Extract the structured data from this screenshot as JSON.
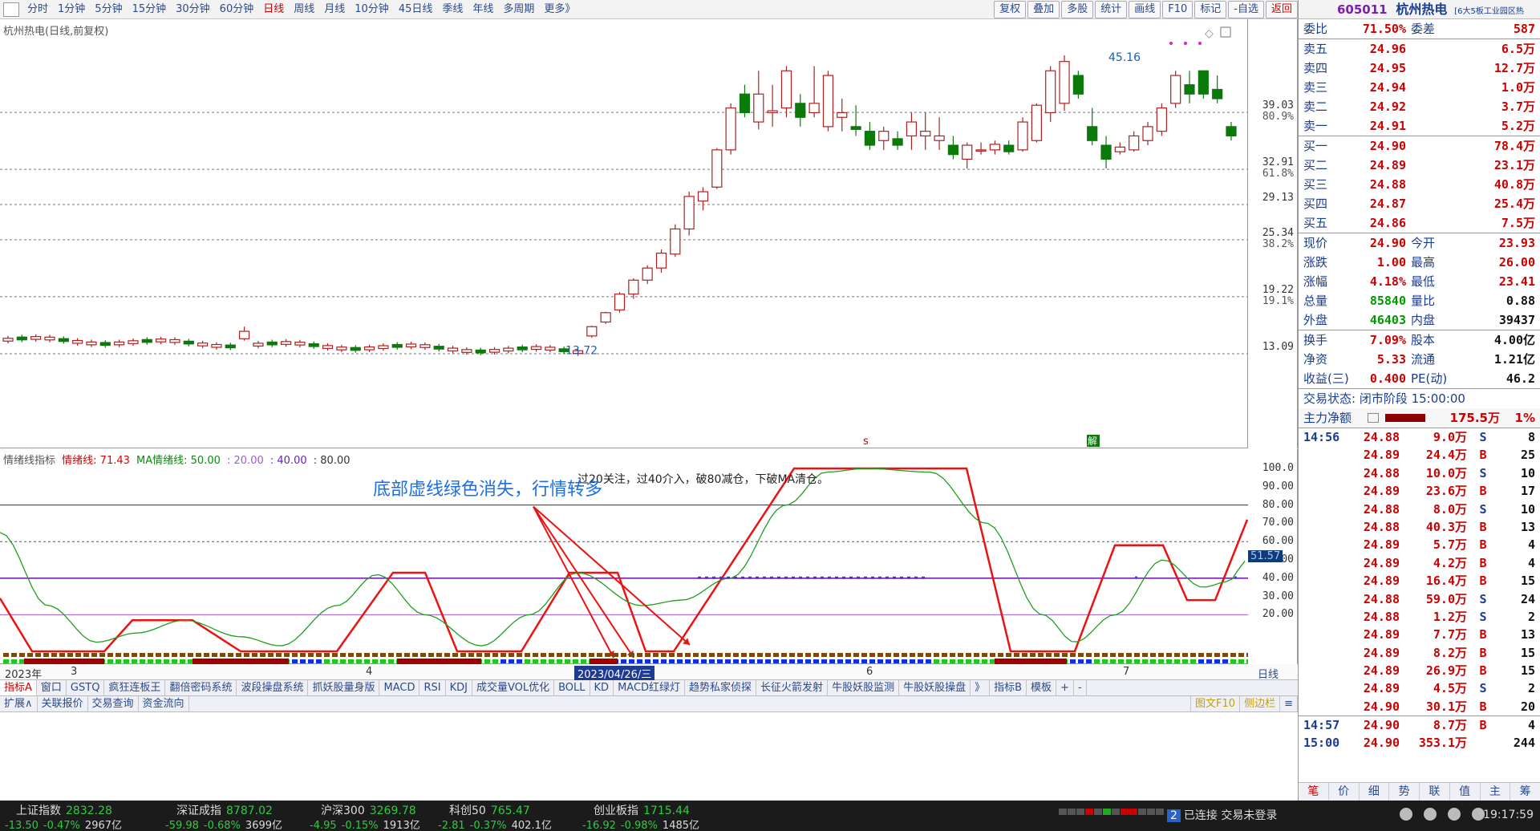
{
  "toolbar": {
    "periods": [
      "分时",
      "1分钟",
      "5分钟",
      "15分钟",
      "30分钟",
      "60分钟",
      "日线",
      "周线",
      "月线",
      "10分钟",
      "45日线",
      "季线",
      "年线",
      "多周期",
      "更多》"
    ],
    "active": "日线",
    "right_buttons": [
      "复权",
      "叠加",
      "多股",
      "统计",
      "画线",
      "F10",
      "标记",
      "-自选",
      "返回"
    ]
  },
  "main_pane": {
    "title": "杭州热电(日线,前复权)",
    "high_label": "45.16",
    "low_label": "13.72",
    "axis_ticks": [
      {
        "v": "39.03",
        "pct": "80.9%"
      },
      {
        "v": "32.91",
        "pct": "61.8%"
      },
      {
        "v": "29.13",
        "pct": ""
      },
      {
        "v": "25.34",
        "pct": "38.2%"
      },
      {
        "v": "19.22",
        "pct": "19.1%"
      },
      {
        "v": "13.09",
        "pct": ""
      }
    ],
    "markers": {
      "s": "s",
      "jie": "解"
    },
    "colors": {
      "up": "#b02020",
      "down": "#0b7a0b"
    }
  },
  "indicator": {
    "name": "情绪线指标",
    "line_label": "情绪线: 71.43",
    "ma_label": "MA情绪线: 50.00",
    "levels": [
      ": 20.00",
      ": 40.00",
      ": 80.00"
    ],
    "note": "过20关注，过40介入，破80减仓，下破MA清仓。",
    "annotation": "底部虚线绿色消失，行情转多",
    "axis_ticks": [
      "100.0",
      "90.00",
      "80.00",
      "70.00",
      "60.00",
      "50.00",
      "40.00",
      "30.00",
      "20.00"
    ],
    "current_value": "51.57"
  },
  "date_axis": {
    "year": "2023年",
    "m3": "3",
    "m4": "4",
    "cur": "2023/04/26/三",
    "m6": "6",
    "m7": "7",
    "mode": "日线"
  },
  "tabs1": [
    "指标A",
    "窗口",
    "GSTQ",
    "疯狂连板王",
    "翻倍密码系统",
    "波段操盘系统",
    "抓妖股量身版",
    "MACD",
    "RSI",
    "KDJ",
    "成交量VOL优化",
    "BOLL",
    "KD",
    "MACD红绿灯",
    "趋势私家侦探",
    "长征火箭发射",
    "牛股妖股监测",
    "牛股妖股操盘",
    "》",
    "指标B",
    "模板",
    "+",
    "-"
  ],
  "tabs2": [
    "扩展∧",
    "关联报价",
    "交易查询",
    "资金流向"
  ],
  "tabs2_right": [
    "图文F10",
    "侧边栏",
    "≡"
  ],
  "status": {
    "indices": [
      {
        "name": "上证指数",
        "val": "2832.28",
        "chg": "-13.50",
        "pct": "-0.47%",
        "amt": "2967亿"
      },
      {
        "name": "深证成指",
        "val": "8787.02",
        "chg": "-59.98",
        "pct": "-0.68%",
        "amt": "3699亿"
      },
      {
        "name": "沪深300",
        "val": "3269.78",
        "chg": "-4.95",
        "pct": "-0.15%",
        "amt": "1913亿"
      },
      {
        "name": "科创50",
        "val": "765.47",
        "chg": "-2.81",
        "pct": "-0.37%",
        "amt": "402.1亿"
      },
      {
        "name": "创业板指",
        "val": "1715.44",
        "chg": "-16.92",
        "pct": "-0.98%",
        "amt": "1485亿"
      }
    ],
    "conn_num": "2",
    "conn_text": "已连接 交易未登录",
    "clock": "19:17:59"
  },
  "quote": {
    "code": "605011",
    "name": "杭州热电",
    "tag": "[6大5板工业园区热",
    "weibi": {
      "label": "委比",
      "val": "71.50%",
      "label2": "委差",
      "val2": "587"
    },
    "asks": [
      {
        "label": "卖五",
        "price": "24.96",
        "vol": "6.5万"
      },
      {
        "label": "卖四",
        "price": "24.95",
        "vol": "12.7万"
      },
      {
        "label": "卖三",
        "price": "24.94",
        "vol": "1.0万"
      },
      {
        "label": "卖二",
        "price": "24.92",
        "vol": "3.7万"
      },
      {
        "label": "卖一",
        "price": "24.91",
        "vol": "5.2万"
      }
    ],
    "bids": [
      {
        "label": "买一",
        "price": "24.90",
        "vol": "78.4万"
      },
      {
        "label": "买二",
        "price": "24.89",
        "vol": "23.1万"
      },
      {
        "label": "买三",
        "price": "24.88",
        "vol": "40.8万"
      },
      {
        "label": "买四",
        "price": "24.87",
        "vol": "25.4万"
      },
      {
        "label": "买五",
        "price": "24.86",
        "vol": "7.5万"
      }
    ],
    "stats": [
      {
        "l1": "现价",
        "v1": "24.90",
        "l2": "今开",
        "v2": "23.93"
      },
      {
        "l1": "涨跌",
        "v1": "1.00",
        "l2": "最高",
        "v2": "26.00"
      },
      {
        "l1": "涨幅",
        "v1": "4.18%",
        "l2": "最低",
        "v2": "23.41"
      },
      {
        "l1": "总量",
        "v1": "85840",
        "l2": "量比",
        "v2": "0.88"
      },
      {
        "l1": "外盘",
        "v1": "46403",
        "l2": "内盘",
        "v2": "39437"
      }
    ],
    "stats2": [
      {
        "l1": "换手",
        "v1": "7.09%",
        "l2": "股本",
        "v2": "4.00亿"
      },
      {
        "l1": "净资",
        "v1": "5.33",
        "l2": "流通",
        "v2": "1.21亿"
      },
      {
        "l1": "收益(三)",
        "v1": "0.400",
        "l2": "PE(动)",
        "v2": "46.2"
      }
    ],
    "trade_status": "交易状态: 闭市阶段 15:00:00",
    "main_flow": {
      "label": "主力净额",
      "val": "175.5万",
      "pct": "1%"
    },
    "ticks": [
      {
        "t": "14:56",
        "p": "24.88",
        "q": "9.0万",
        "bs": "S",
        "c": "8"
      },
      {
        "t": "",
        "p": "24.89",
        "q": "24.4万",
        "bs": "B",
        "c": "25"
      },
      {
        "t": "",
        "p": "24.88",
        "q": "10.0万",
        "bs": "S",
        "c": "10"
      },
      {
        "t": "",
        "p": "24.89",
        "q": "23.6万",
        "bs": "B",
        "c": "17"
      },
      {
        "t": "",
        "p": "24.88",
        "q": "8.0万",
        "bs": "S",
        "c": "10"
      },
      {
        "t": "",
        "p": "24.88",
        "q": "40.3万",
        "bs": "B",
        "c": "13"
      },
      {
        "t": "",
        "p": "24.89",
        "q": "5.7万",
        "bs": "B",
        "c": "4"
      },
      {
        "t": "",
        "p": "24.89",
        "q": "4.2万",
        "bs": "B",
        "c": "4"
      },
      {
        "t": "",
        "p": "24.89",
        "q": "16.4万",
        "bs": "B",
        "c": "15"
      },
      {
        "t": "",
        "p": "24.88",
        "q": "59.0万",
        "bs": "S",
        "c": "24"
      },
      {
        "t": "",
        "p": "24.88",
        "q": "1.2万",
        "bs": "S",
        "c": "2"
      },
      {
        "t": "",
        "p": "24.89",
        "q": "7.7万",
        "bs": "B",
        "c": "13"
      },
      {
        "t": "",
        "p": "24.89",
        "q": "8.2万",
        "bs": "B",
        "c": "15"
      },
      {
        "t": "",
        "p": "24.89",
        "q": "26.9万",
        "bs": "B",
        "c": "15"
      },
      {
        "t": "",
        "p": "24.89",
        "q": "4.5万",
        "bs": "S",
        "c": "2"
      },
      {
        "t": "",
        "p": "24.90",
        "q": "30.1万",
        "bs": "B",
        "c": "20"
      },
      {
        "t": "14:57",
        "p": "24.90",
        "q": "8.7万",
        "bs": "B",
        "c": "4"
      },
      {
        "t": "15:00",
        "p": "24.90",
        "q": "353.1万",
        "bs": "",
        "c": "244"
      }
    ],
    "bottom_tabs": [
      "笔",
      "价",
      "细",
      "势",
      "联",
      "值",
      "主",
      "筹"
    ]
  }
}
